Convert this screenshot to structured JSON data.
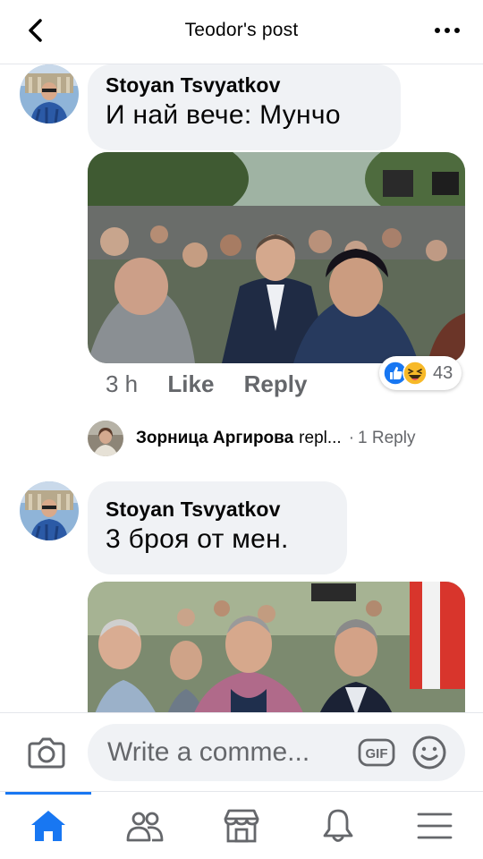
{
  "header": {
    "title": "Teodor's post"
  },
  "comments": [
    {
      "author": "Stoyan Tsvyatkov",
      "text": "И най вече: Мунчо",
      "time": "3 h",
      "like_label": "Like",
      "reply_label": "Reply",
      "reactions": {
        "icons": [
          "like-icon",
          "haha-icon"
        ],
        "count": "43"
      }
    },
    {
      "author": "Stoyan Tsvyatkov",
      "text": "3 броя от мен."
    }
  ],
  "reply_preview": {
    "name": "Зорница Аргирова",
    "verb": "repl...",
    "separator": "·",
    "count_label": "1 Reply"
  },
  "composer": {
    "placeholder": "Write a comme...",
    "gif_label": "GIF"
  },
  "tabs": [
    {
      "name": "home",
      "active": true
    },
    {
      "name": "friends",
      "active": false
    },
    {
      "name": "marketplace",
      "active": false
    },
    {
      "name": "notifications",
      "active": false
    },
    {
      "name": "menu",
      "active": false
    }
  ],
  "colors": {
    "accent": "#1877f2",
    "bubble": "#f0f2f5",
    "secondary_text": "#65676b",
    "haha": "#f7b928"
  }
}
